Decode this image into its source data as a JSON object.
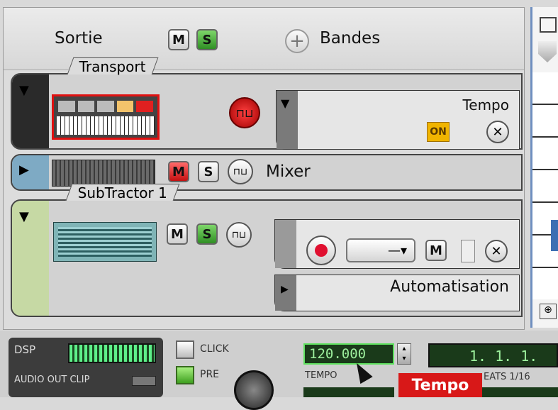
{
  "header": {
    "output_label": "Sortie",
    "m_label": "M",
    "s_label": "S",
    "bands_label": "Bandes"
  },
  "transport_track": {
    "tab_label": "Transport",
    "tempo_label": "Tempo",
    "on_label": "ON"
  },
  "mixer_track": {
    "m_label": "M",
    "s_label": "S",
    "name": "Mixer"
  },
  "subtractor_track": {
    "tab_label": "SubTractor 1",
    "m_label": "M",
    "s_label": "S",
    "lane_m_label": "M",
    "automation_label": "Automatisation"
  },
  "transport_bar": {
    "dsp_label": "DSP",
    "audio_out_clip_label": "AUDIO OUT CLIP",
    "click_label": "CLICK",
    "pre_label": "PRE",
    "tempo_value": "120.000",
    "tempo_caption": "TEMPO",
    "tooltip": "Tempo",
    "position_value": "1. 1. 1.",
    "beats_label": "EATS 1/16"
  },
  "colors": {
    "accent_green": "#2f8f24",
    "mute_red": "#c41010",
    "lcd_green": "#9df09d",
    "tooltip_red": "#d81818"
  }
}
